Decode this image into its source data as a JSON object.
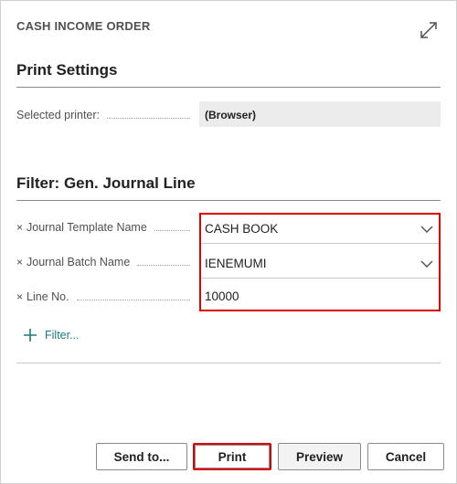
{
  "dialog": {
    "caption": "CASH INCOME ORDER",
    "expand_icon": "expand-arrows-icon"
  },
  "print_settings": {
    "title": "Print Settings",
    "printer_label": "Selected printer:",
    "printer_value": "(Browser)"
  },
  "filter": {
    "title": "Filter: Gen. Journal Line",
    "remove_glyph": "×",
    "fields": [
      {
        "label": "Journal Template Name",
        "value": "CASH BOOK",
        "has_dropdown": true
      },
      {
        "label": "Journal Batch Name",
        "value": "IENEMUMI",
        "has_dropdown": true
      },
      {
        "label": "Line No.",
        "value": "10000",
        "has_dropdown": false
      }
    ],
    "add_filter_label": "Filter...",
    "highlight_color": "#e00000"
  },
  "buttons": {
    "send_to": "Send to...",
    "print": "Print",
    "preview": "Preview",
    "cancel": "Cancel"
  },
  "colors": {
    "accent_link": "#1f7a7a",
    "highlight": "#e00000",
    "readonly_bg": "#ececec"
  }
}
